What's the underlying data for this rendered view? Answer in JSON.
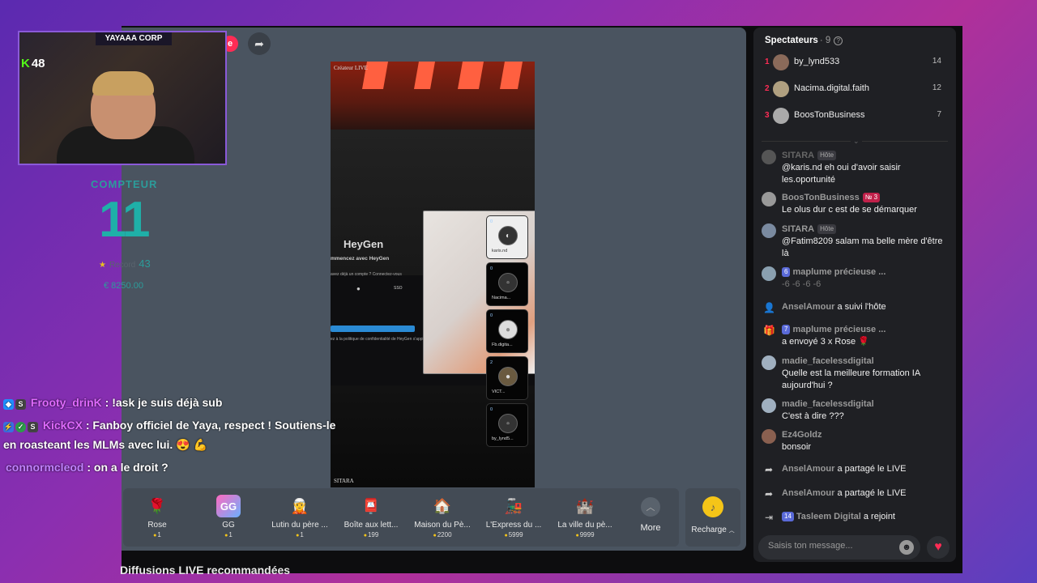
{
  "overlay": {
    "cam_title": "YAYAAA CORP",
    "kick_count": "48",
    "counter": {
      "label": "COMPTEUR",
      "value": "11",
      "rating_label": "Record",
      "rating_value": "43",
      "money": "€ 8250.00"
    },
    "chat": [
      {
        "user": "Frooty_drinK",
        "text": ": !ask je suis déjà sub"
      },
      {
        "user": "KickCX",
        "text": ": Fanboy officiel de Yaya, respect ! Soutiens-le",
        "text2": "en roasteant les MLMs avec lui. 😍 💪"
      },
      {
        "user": "connormcleod",
        "text": ": on a le droit ?"
      }
    ]
  },
  "stream": {
    "live_badge": "e",
    "video_label": "Créateur LIVE",
    "video_host": "SITARA",
    "heygen_brand": "HeyGen",
    "heygen_title": "mmencez avec HeyGen",
    "heygen_sub": "avez déjà un compte ? Connectez-vous",
    "heygen_sso": "SSO",
    "heygen_note": "ez à la politique de confidentialité de HeyGen s'appliquent",
    "tiles": [
      {
        "badge": "0",
        "name": "karis.nd"
      },
      {
        "badge": "0",
        "name": "Nacima..."
      },
      {
        "badge": "0",
        "name": "Fb.digita..."
      },
      {
        "badge": "2",
        "name": "VICT..."
      },
      {
        "badge": "0",
        "name": "by_lynd5..."
      }
    ],
    "recommended": "Diffusions LIVE recommandées"
  },
  "gifts": [
    {
      "name": "Rose",
      "price": "1",
      "icon": "🌹"
    },
    {
      "name": "GG",
      "price": "1",
      "icon": "GG"
    },
    {
      "name": "Lutin du père ...",
      "price": "1",
      "icon": "🧝"
    },
    {
      "name": "Boîte aux lett...",
      "price": "199",
      "icon": "📮"
    },
    {
      "name": "Maison du Pè...",
      "price": "2200",
      "icon": "🏠"
    },
    {
      "name": "L'Express du ...",
      "price": "5999",
      "icon": "🚂"
    },
    {
      "name": "La ville du pè...",
      "price": "9999",
      "icon": "🏰"
    }
  ],
  "more_label": "More",
  "recharge_label": "Recharge",
  "spectators": {
    "title": "Spectateurs",
    "count": "· 9",
    "list": [
      {
        "rank": "1",
        "name": "by_lynd533",
        "score": "14"
      },
      {
        "rank": "2",
        "name": "Nacima.digital.faith",
        "score": "12"
      },
      {
        "rank": "3",
        "name": "BoosTonBusiness",
        "score": "7"
      }
    ]
  },
  "messages": {
    "m1": {
      "user": "SITARA",
      "tag": "Hôte",
      "text": "@karis.nd eh oui d'avoir saisir les.oportunité"
    },
    "m2": {
      "user": "BoosTonBusiness",
      "tag": "№ 3",
      "text": "Le olus dur c est de se démarquer"
    },
    "m3": {
      "user": "SITARA",
      "tag": "Hôte",
      "text": "@Fatim8209 salam ma belle mère d'être là"
    },
    "m4": {
      "level": "6",
      "user": "maplume précieuse ...",
      "text": "-6 -6 -6 -6"
    },
    "m5": {
      "user": "AnselAmour",
      "text": "a suivi l'hôte"
    },
    "m6": {
      "level": "7",
      "user": "maplume précieuse ...",
      "text": "a envoyé 3 x Rose 🌹"
    },
    "m7": {
      "user": "madie_facelessdigital",
      "text": "Quelle est la meilleure formation IA aujourd'hui ?"
    },
    "m8": {
      "user": "madie_facelessdigital",
      "text": "C'est à dire ???"
    },
    "m9": {
      "user": "Ez4Goldz",
      "text": "bonsoir"
    },
    "m10": {
      "user": "AnselAmour",
      "text": "a partagé le LIVE"
    },
    "m11": {
      "user": "AnselAmour",
      "text": "a partagé le LIVE"
    },
    "m12": {
      "level": "14",
      "user": "Tasleem Digital",
      "text": "a rejoint"
    }
  },
  "input": {
    "placeholder": "Saisis ton message..."
  }
}
